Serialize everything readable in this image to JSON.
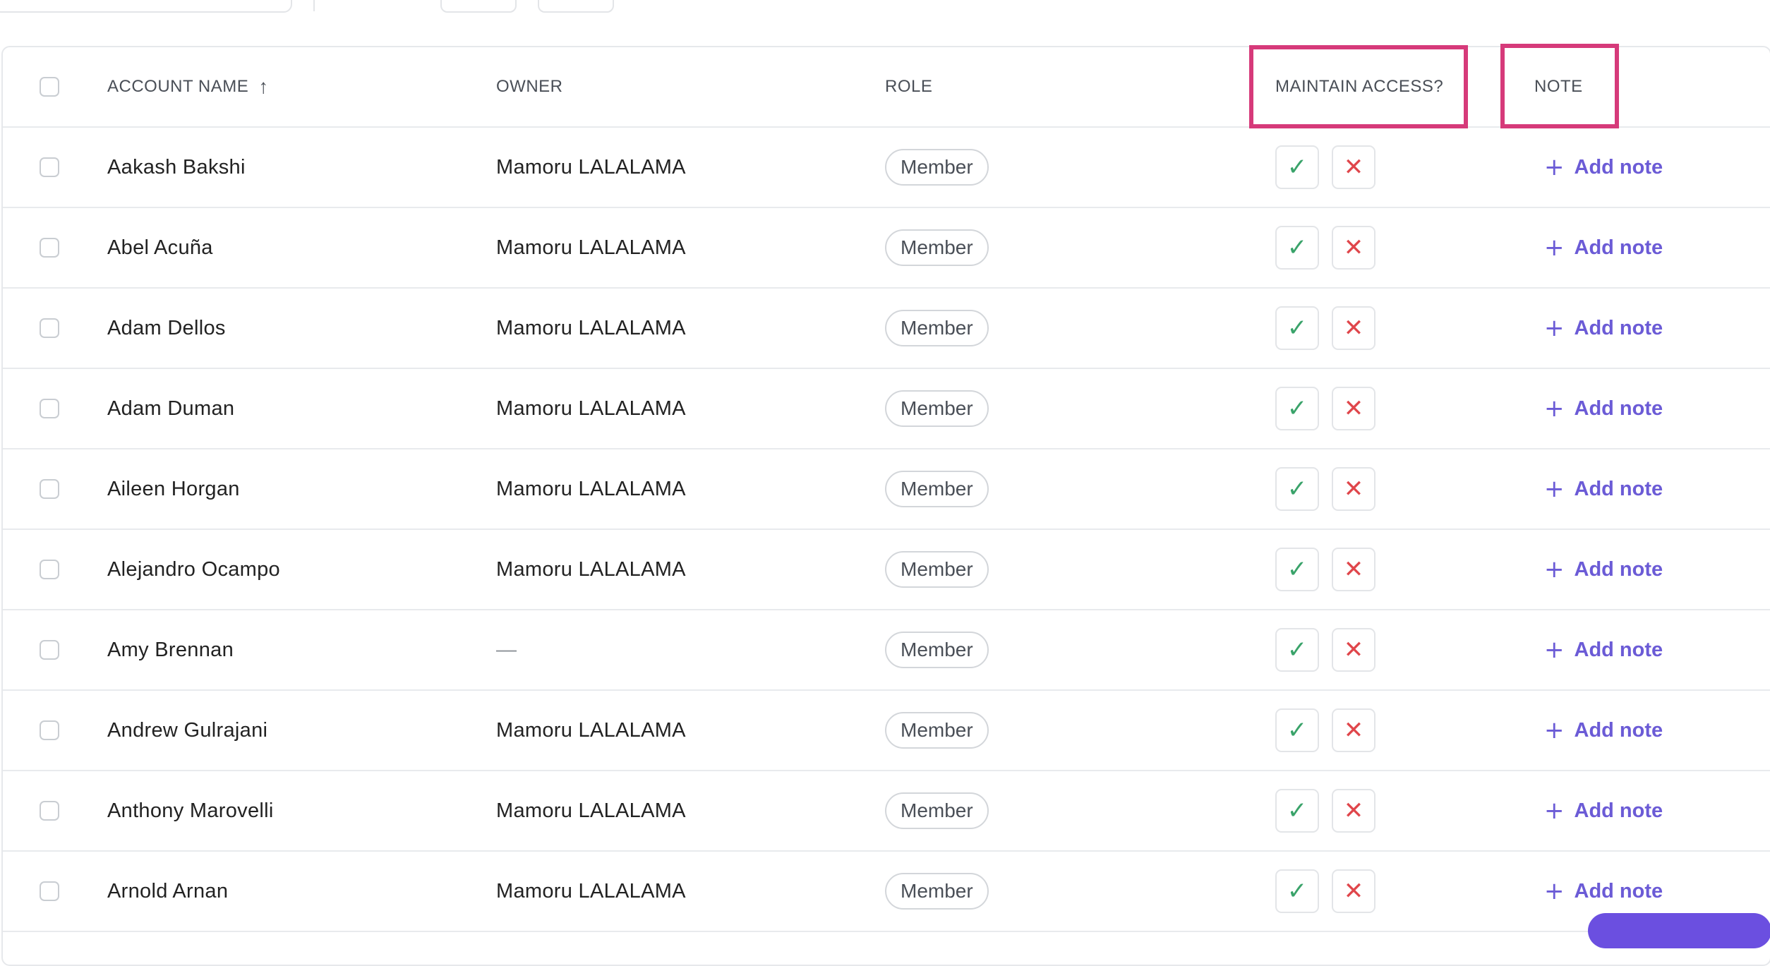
{
  "header": {
    "account_name": "ACCOUNT NAME",
    "owner": "OWNER",
    "role": "ROLE",
    "maintain_access": "MAINTAIN ACCESS?",
    "note": "NOTE",
    "sort_icon": "arrow-up-icon"
  },
  "actions": {
    "add_note": "Add note",
    "approve_icon": "check-icon",
    "deny_icon": "x-icon",
    "add_icon": "plus-icon"
  },
  "colors": {
    "accent": "#6b5bd6",
    "approve": "#3aa36a",
    "deny": "#e0464b",
    "highlight": "#d63a7a"
  },
  "rows": [
    {
      "name": "Aakash Bakshi",
      "owner": "Mamoru LALALAMA",
      "role": "Member"
    },
    {
      "name": "Abel Acuña",
      "owner": "Mamoru LALALAMA",
      "role": "Member"
    },
    {
      "name": "Adam Dellos",
      "owner": "Mamoru LALALAMA",
      "role": "Member"
    },
    {
      "name": "Adam Duman",
      "owner": "Mamoru LALALAMA",
      "role": "Member"
    },
    {
      "name": "Aileen Horgan",
      "owner": "Mamoru LALALAMA",
      "role": "Member"
    },
    {
      "name": "Alejandro Ocampo",
      "owner": "Mamoru LALALAMA",
      "role": "Member"
    },
    {
      "name": "Amy Brennan",
      "owner": "—",
      "role": "Member"
    },
    {
      "name": "Andrew Gulrajani",
      "owner": "Mamoru LALALAMA",
      "role": "Member"
    },
    {
      "name": "Anthony Marovelli",
      "owner": "Mamoru LALALAMA",
      "role": "Member"
    },
    {
      "name": "Arnold Arnan",
      "owner": "Mamoru LALALAMA",
      "role": "Member"
    }
  ]
}
